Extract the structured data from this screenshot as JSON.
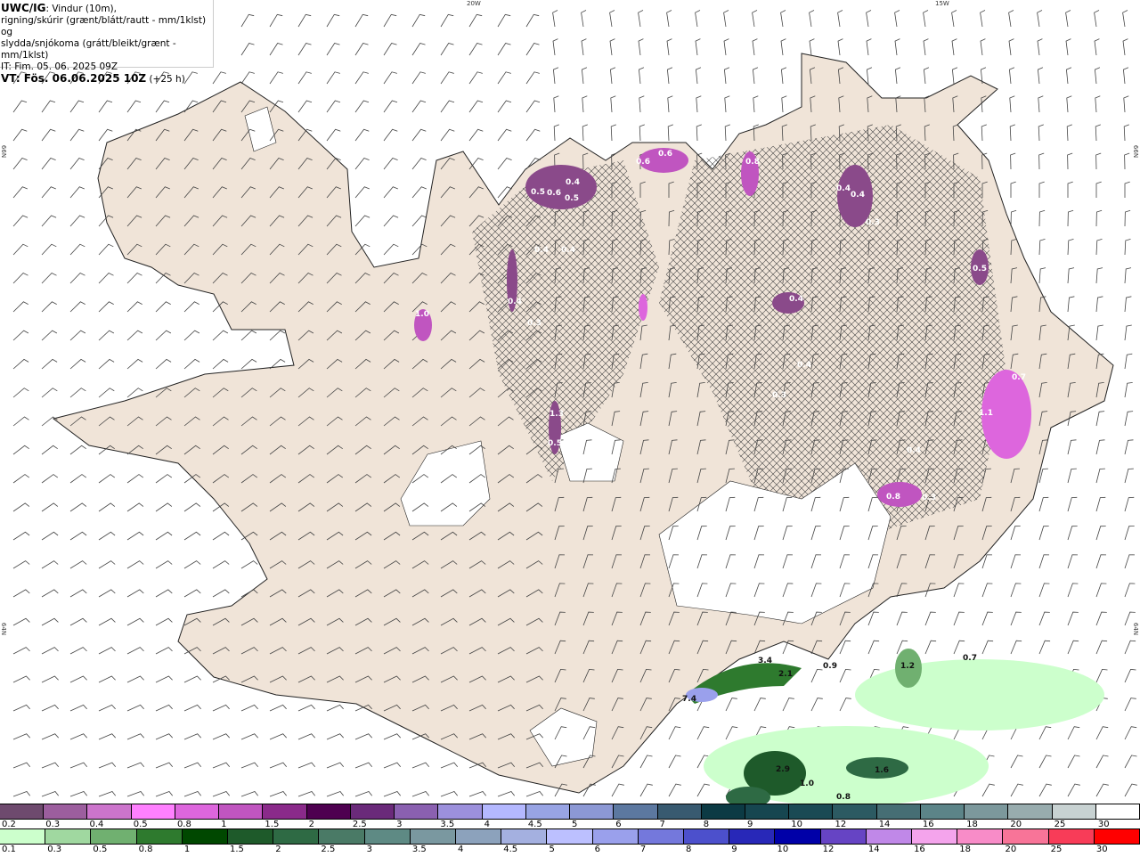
{
  "header": {
    "source": "UWC/IG",
    "title_rest": ": Vindur (10m),",
    "line2": "rigning/skúrir (grænt/blátt/rautt - mm/1klst) og",
    "line3": "slydda/snjókoma (grátt/bleikt/grænt - mm/1klst)",
    "it": "IT: Fim. 05. 06. 2025 09Z",
    "vt": "VT: Fös. 06.06.2025 10Z",
    "lead": " (+25 h)"
  },
  "graticule": {
    "lon_left": "20W",
    "lon_right": "15W",
    "lat_top_left": "66N",
    "lat_bottom_left": "64N",
    "lat_top_right": "66N",
    "lat_bottom_right": "64N"
  },
  "colors": {
    "land": "#f0e4d8",
    "glacier": "#ffffff",
    "roads": "#ee6a3a",
    "coast": "#222222"
  },
  "snow_maxima": [
    "0.5",
    "0.6",
    "0.4",
    "0.5",
    "0.4",
    "0.4",
    "0.6",
    "0.6",
    "0.8",
    "0.4",
    "0.4",
    "0.3",
    "0.5",
    "0.4",
    "0.4",
    "0.3",
    "1.0",
    "0.4",
    "0.3",
    "1.3",
    "0.5",
    "0.7",
    "1.1",
    "0.4",
    "0.8",
    "0.3"
  ],
  "rain_maxima": [
    "3.4",
    "2.1",
    "0.9",
    "7.4",
    "1.2",
    "0.7",
    "2.9",
    "1.0",
    "0.8",
    "1.6"
  ],
  "legend_snow": {
    "labels": [
      "0.2",
      "0.3",
      "0.4",
      "0.5",
      "0.8",
      "1",
      "1.5",
      "2",
      "2.5",
      "3",
      "3.5",
      "4",
      "4.5",
      "5",
      "6",
      "7",
      "8",
      "9",
      "10",
      "12",
      "14",
      "16",
      "18",
      "20",
      "25",
      "30"
    ],
    "colors": [
      "#6e4a6e",
      "#9c5e9e",
      "#cc74cc",
      "#ff80ff",
      "#dd66dd",
      "#c055c0",
      "#8a2a8a",
      "#4e0050",
      "#6a2a7a",
      "#8a60b0",
      "#9c90dc",
      "#b4b8ff",
      "#98a4e4",
      "#8c98d4",
      "#5c78a0",
      "#385a70",
      "#0c3a44",
      "#164650",
      "#1a4a54",
      "#2c5a62",
      "#466e74",
      "#5c8488",
      "#7c989c",
      "#98acae",
      "#c8d2d2",
      "#ffffff"
    ]
  },
  "legend_rain": {
    "labels": [
      "0.1",
      "0.3",
      "0.5",
      "0.8",
      "1",
      "1.5",
      "2",
      "2.5",
      "3",
      "3.5",
      "4",
      "4.5",
      "5",
      "6",
      "7",
      "8",
      "9",
      "10",
      "12",
      "14",
      "16",
      "18",
      "20",
      "25",
      "30"
    ],
    "colors": [
      "#ccffcc",
      "#a0d8a0",
      "#70b070",
      "#2e7a2e",
      "#004800",
      "#1e5a2a",
      "#2e6a44",
      "#4a7a66",
      "#5e8a84",
      "#7a98a0",
      "#8ca2bc",
      "#a4b0e0",
      "#bcc0ff",
      "#9aa0ec",
      "#7478dc",
      "#4c50cc",
      "#2828b8",
      "#0000a8",
      "#6644c4",
      "#c088e8",
      "#f4a4ec",
      "#f88cc8",
      "#f87498",
      "#f83c58",
      "#ff0000"
    ]
  }
}
